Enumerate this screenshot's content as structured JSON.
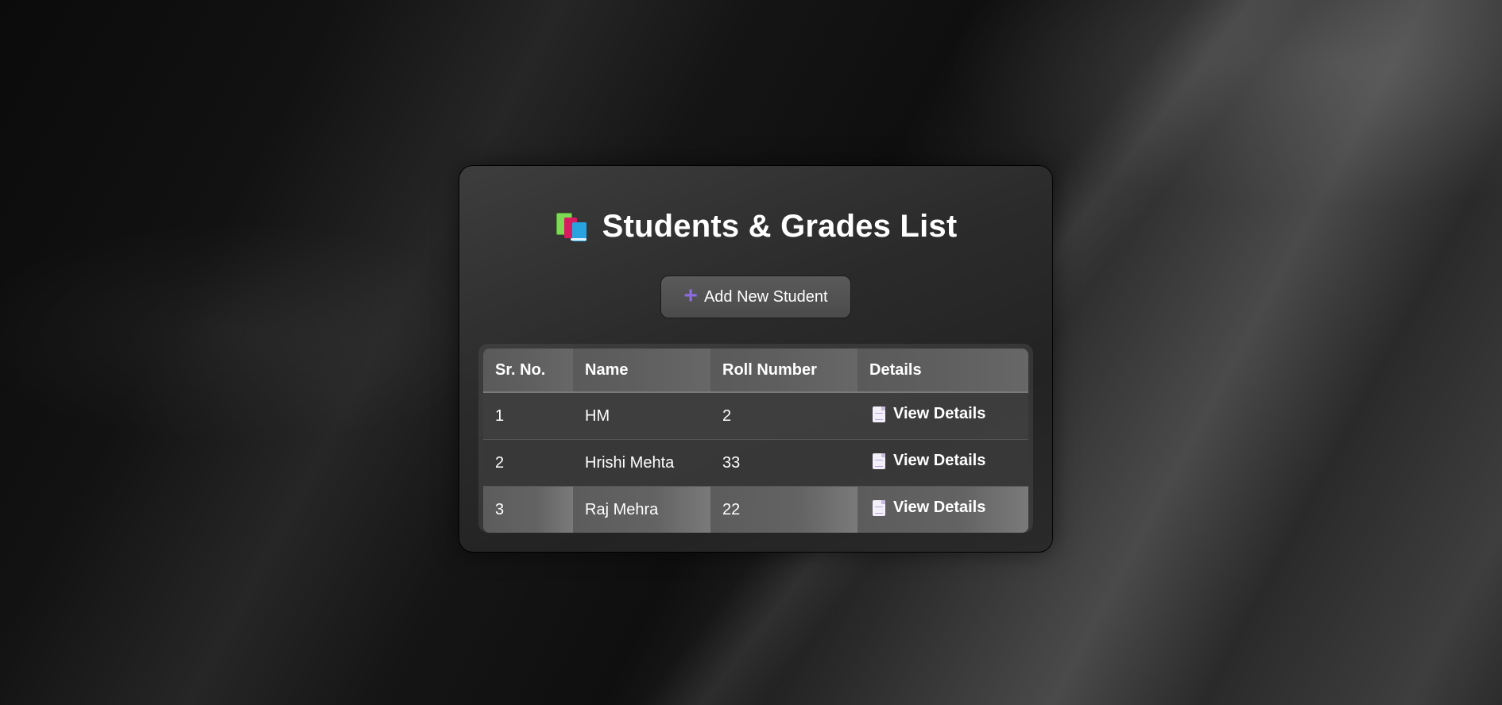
{
  "page": {
    "title": "Students & Grades List",
    "title_icon": "books-icon"
  },
  "actions": {
    "add_student_label": "Add New Student",
    "add_icon": "plus-icon",
    "add_icon_color": "#8c6ae0"
  },
  "table": {
    "headers": [
      "Sr. No.",
      "Name",
      "Roll Number",
      "Details"
    ],
    "rows": [
      {
        "sr": "1",
        "name": "HM",
        "roll": "2",
        "details_label": "View Details"
      },
      {
        "sr": "2",
        "name": "Hrishi Mehta",
        "roll": "33",
        "details_label": "View Details"
      },
      {
        "sr": "3",
        "name": "Raj Mehra",
        "roll": "22",
        "details_label": "View Details"
      }
    ],
    "details_icon": "document-icon"
  }
}
